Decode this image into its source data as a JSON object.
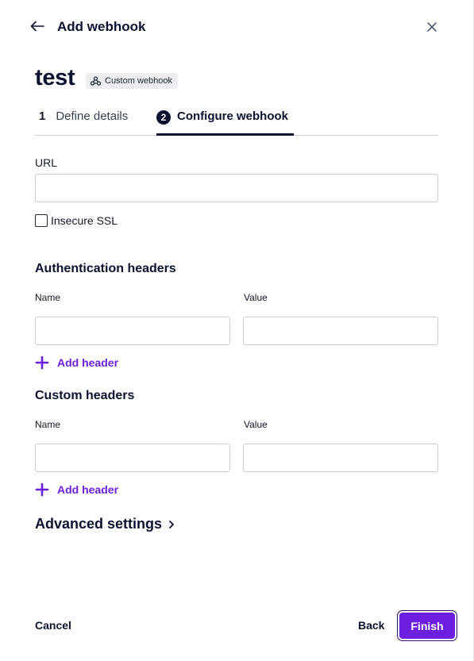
{
  "header": {
    "title": "Add webhook",
    "back_icon": "arrow-left-icon",
    "close_icon": "close-icon"
  },
  "page": {
    "title": "test",
    "badge": "Custom webhook",
    "badge_icon": "webhook-icon"
  },
  "steps": [
    {
      "number": "1",
      "label": "Define details",
      "active": false
    },
    {
      "number": "2",
      "label": "Configure webhook",
      "active": true
    }
  ],
  "url": {
    "label": "URL",
    "value": "",
    "placeholder": ""
  },
  "insecure_ssl": {
    "label": "Insecure SSL",
    "checked": false
  },
  "auth_headers": {
    "title": "Authentication headers",
    "name_label": "Name",
    "value_label": "Value",
    "name_value": "",
    "value_value": "",
    "add_label": "Add header"
  },
  "custom_headers": {
    "title": "Custom headers",
    "name_label": "Name",
    "value_label": "Value",
    "name_value": "",
    "value_value": "",
    "add_label": "Add header"
  },
  "advanced": {
    "label": "Advanced settings"
  },
  "footer": {
    "cancel_label": "Cancel",
    "back_label": "Back",
    "finish_label": "Finish"
  },
  "colors": {
    "accent": "#6b1fe0",
    "text_dark": "#0b1230",
    "border": "#c9ced6"
  }
}
